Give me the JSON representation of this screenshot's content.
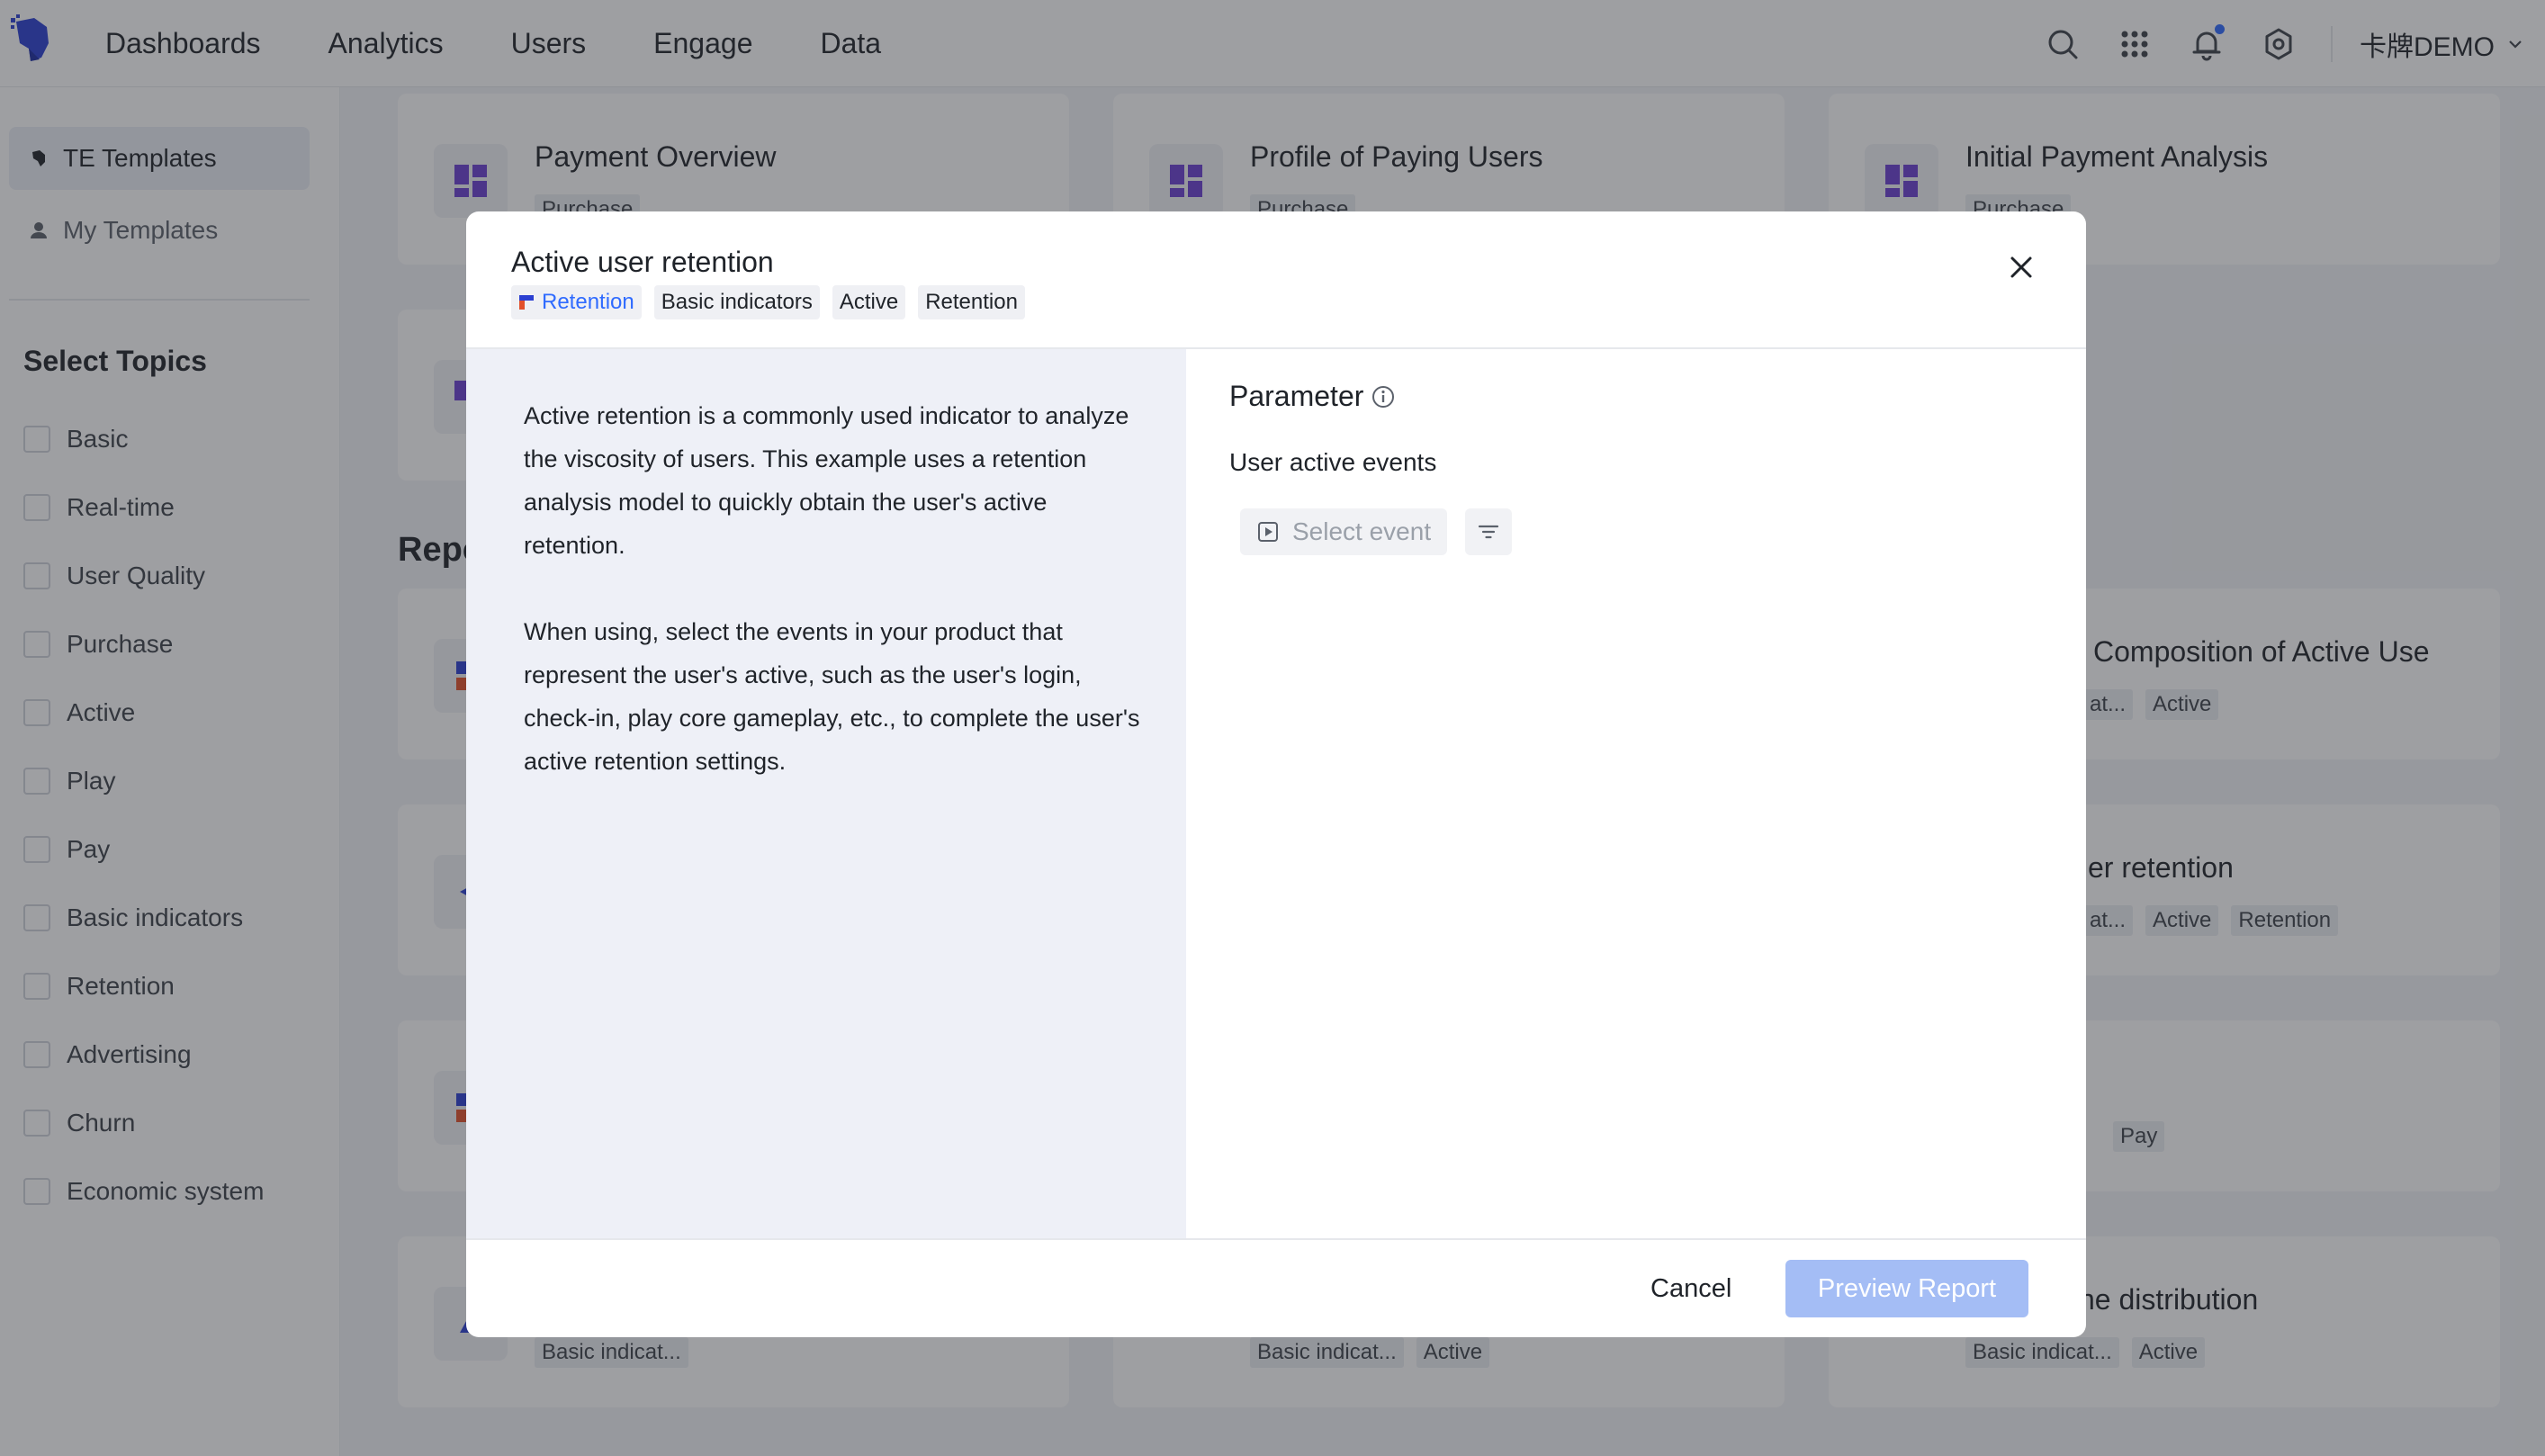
{
  "nav": {
    "items": [
      "Dashboards",
      "Analytics",
      "Users",
      "Engage",
      "Data"
    ],
    "account_label": "卡牌DEMO"
  },
  "sidebar": {
    "tabs": [
      {
        "label": "TE Templates",
        "active": true
      },
      {
        "label": "My Templates",
        "active": false
      }
    ],
    "topics_title": "Select Topics",
    "topics": [
      "Basic",
      "Real-time",
      "User Quality",
      "Purchase",
      "Active",
      "Play",
      "Pay",
      "Basic indicators",
      "Retention",
      "Advertising",
      "Churn",
      "Economic system"
    ]
  },
  "background": {
    "section_title": "Repo",
    "cards": [
      {
        "title": "Payment Overview",
        "tags": [
          "Purchase"
        ]
      },
      {
        "title": "Profile of Paying Users",
        "tags": [
          "Purchase"
        ]
      },
      {
        "title": "Initial Payment Analysis",
        "tags": [
          "Purchase"
        ]
      },
      {
        "title": "Composition of Active Use",
        "tags": [
          "at...",
          "Active"
        ]
      },
      {
        "title": "er retention",
        "tags": [
          "at...",
          "Active",
          "Retention"
        ]
      },
      {
        "title": "",
        "tags": [
          "Pay"
        ]
      },
      {
        "title": "",
        "tags": [
          "Basic indicat..."
        ]
      },
      {
        "title": "",
        "tags": [
          "Basic indicat...",
          "Active"
        ]
      },
      {
        "title": "ne distribution",
        "tags": [
          "Basic indicat...",
          "Active"
        ]
      }
    ]
  },
  "modal": {
    "title": "Active user retention",
    "tags": [
      {
        "label": "Retention",
        "primary": true
      },
      {
        "label": "Basic indicators",
        "primary": false
      },
      {
        "label": "Active",
        "primary": false
      },
      {
        "label": "Retention",
        "primary": false
      }
    ],
    "description": [
      "Active retention is a commonly used indicator to analyze the viscosity of users. This example uses a retention analysis model to quickly obtain the user's active retention.",
      "When using, select the events in your product that represent the user's active, such as the user's login, check-in, play core gameplay, etc., to complete the user's active retention settings."
    ],
    "parameter_title": "Parameter",
    "events_label": "User active events",
    "select_event_label": "Select event",
    "cancel_label": "Cancel",
    "preview_label": "Preview Report"
  },
  "colors": {
    "accent": "#2f6bff",
    "preview_button_disabled": "#a4bdf5",
    "modal_left_panel": "#eef0f7"
  }
}
